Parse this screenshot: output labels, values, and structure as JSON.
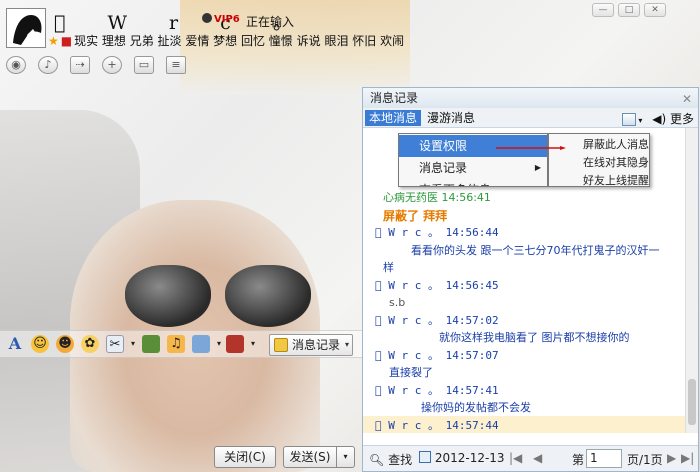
{
  "header": {
    "username": "\u0000 W r c 。",
    "vip_badge": "VIP6",
    "status_text": "正在输入",
    "signature": "现实 理想 兄弟 扯淡 爱情 梦想 回忆 憧憬 诉说 眼泪 怀旧 欢闹"
  },
  "window_controls": {
    "min": "—",
    "max": "□",
    "close": "✕"
  },
  "top_toolbar_icons": [
    "video-icon",
    "microphone-icon",
    "transfer-icon",
    "add-contact-icon",
    "desktop-share-icon",
    "notes-icon"
  ],
  "input_toolbar": {
    "font_label": "A",
    "history_button": "消息记录"
  },
  "bottom_buttons": {
    "close": "关闭(C)",
    "send": "发送(S)"
  },
  "panel": {
    "title": "消息记录",
    "tabs": [
      "本地消息",
      "漫游消息"
    ],
    "more_label": "更多",
    "messages": [
      {
        "text": "心病无药医  14:56:41",
        "style": "green",
        "indent": 20
      },
      {
        "text": "屏蔽了  拜拜",
        "style": "orange",
        "indent": 20
      },
      {
        "text": "\u0000 W r c 。 14:56:44",
        "style": "hdr",
        "indent": 12
      },
      {
        "text": "看看你的头发 跟一个三七分70年代打鬼子的汉奸一",
        "style": "body",
        "indent": 48
      },
      {
        "text": "样",
        "style": "body",
        "indent": 20
      },
      {
        "text": "\u0000 W r c 。 14:56:45",
        "style": "hdr",
        "indent": 12
      },
      {
        "text": "s.b",
        "style": "gray",
        "indent": 26
      },
      {
        "text": "\u0000 W r c 。 14:57:02",
        "style": "hdr",
        "indent": 12
      },
      {
        "text": "就你这样我电脑看了 图片都不想接你的",
        "style": "body",
        "indent": 76
      },
      {
        "text": "\u0000 W r c 。 14:57:07",
        "style": "hdr",
        "indent": 12
      },
      {
        "text": "直接裂了",
        "style": "body",
        "indent": 26
      },
      {
        "text": "\u0000 W r c 。 14:57:41",
        "style": "hdr",
        "indent": 12
      },
      {
        "text": "操你妈的发帖都不会发",
        "style": "body",
        "indent": 58
      },
      {
        "text": "\u0000 W r c 。 14:57:44",
        "style": "hdr",
        "indent": 12
      }
    ],
    "footer": {
      "search": "查找",
      "date": "2012-12-13",
      "page_prefix": "第",
      "page_value": "1",
      "page_suffix": "页/1页"
    }
  },
  "context_menu": {
    "items": [
      "设置权限",
      "消息记录",
      "查看更多信息"
    ],
    "submenu": [
      "屏蔽此人消息",
      "在线对其隐身",
      "好友上线提醒"
    ]
  },
  "colors": {
    "accent": "#3a7bd5",
    "message_blue": "#1a3fa8",
    "green": "#2e9a3b",
    "orange": "#e57b00"
  }
}
